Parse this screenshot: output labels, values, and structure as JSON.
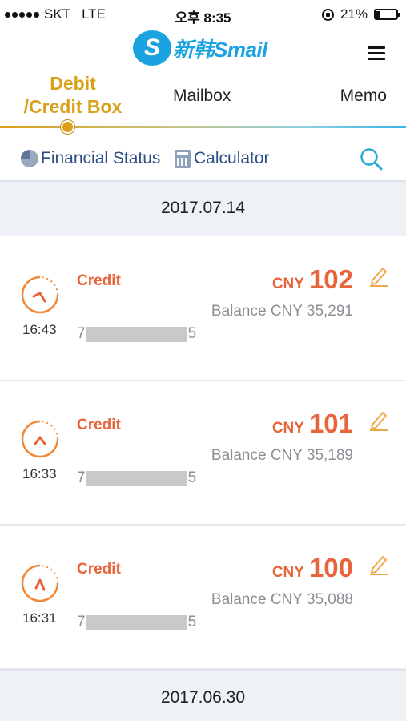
{
  "status_bar": {
    "carrier": "SKT",
    "network": "LTE",
    "time": "오후 8:35",
    "battery": "21%",
    "battery_level": 0.21
  },
  "header": {
    "logo_mark": "S",
    "logo_text": "新韩Smail",
    "menu_icon": "hamburger-icon"
  },
  "tabs": {
    "items": [
      {
        "line1": "Debit",
        "line2": "/Credit Box",
        "active": true
      },
      {
        "label": "Mailbox",
        "active": false
      },
      {
        "label": "Memo",
        "active": false
      }
    ],
    "active_color": "#d9a019"
  },
  "toolbar": {
    "financial_status": "Financial Status",
    "calculator": "Calculator",
    "search_icon": "search-icon"
  },
  "dates": [
    "2017.07.14",
    "2017.06.30"
  ],
  "colors": {
    "accent_orange": "#e8643b",
    "brand_blue": "#1aa3e0",
    "link_navy": "#2c4f86"
  },
  "transactions": [
    {
      "type": "Credit",
      "currency": "CNY",
      "amount": "102",
      "balance": "Balance CNY 35,291",
      "time": "16:43",
      "account_start": "7",
      "account_end": "5"
    },
    {
      "type": "Credit",
      "currency": "CNY",
      "amount": "101",
      "balance": "Balance CNY 35,189",
      "time": "16:33",
      "account_start": "7",
      "account_end": "5"
    },
    {
      "type": "Credit",
      "currency": "CNY",
      "amount": "100",
      "balance": "Balance CNY 35,088",
      "time": "16:31",
      "account_start": "7",
      "account_end": "5"
    }
  ]
}
